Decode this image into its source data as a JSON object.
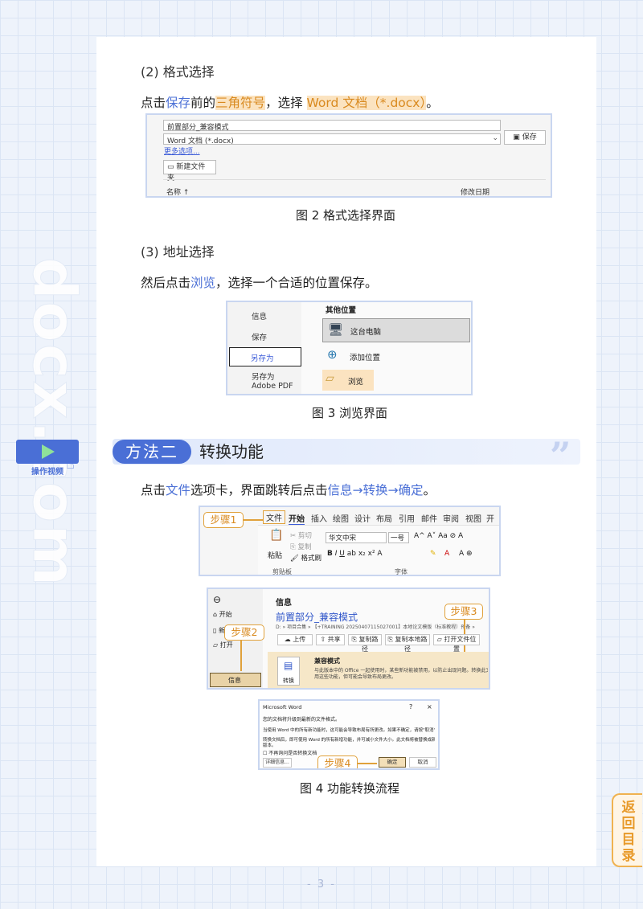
{
  "watermark": "docx.com",
  "section3": {
    "title": "(2) 格式选择"
  },
  "para1": {
    "p1": "点击",
    "p2": "保存",
    "p3": "前的",
    "p4": "三角符号",
    "p5": "，选择 ",
    "p6": "Word 文档（*.docx）",
    "p7": "。"
  },
  "fig2": {
    "filename": "前置部分_兼容模式",
    "filetype": "Word 文档 (*.docx)",
    "more_options": "更多选项...",
    "save_label": "保存",
    "new_folder_label": "新建文件夹",
    "col_name": "名称 ↑",
    "col_date": "修改日期"
  },
  "caption2": "图 2  格式选择界面",
  "section4": {
    "title": "(3) 地址选择"
  },
  "para2": {
    "p1": "然后点击",
    "p2": "浏览",
    "p3": "，选择一个合适的位置保存。"
  },
  "fig3": {
    "items": [
      "信息",
      "保存",
      "另存为",
      "另存为 Adobe PDF"
    ],
    "heading": "其他位置",
    "options": [
      "这台电脑",
      "添加位置",
      "浏览"
    ]
  },
  "caption3": "图 3  浏览界面",
  "method": {
    "pill": "方法二",
    "title": "转换功能"
  },
  "video_btn_label": "操作视频",
  "para3": {
    "p1": "点击",
    "p2": "文件",
    "p3": "选项卡，界面跳转后点击",
    "p4": "信息→转换→确定",
    "p5": "。"
  },
  "fig4a": {
    "step": "步骤1",
    "tabs": [
      "文件",
      "开始",
      "插入",
      "绘图",
      "设计",
      "布局",
      "引用",
      "邮件",
      "审阅",
      "视图",
      "开发"
    ],
    "clip_items": [
      "剪切",
      "复制",
      "格式刷"
    ],
    "paste": "粘贴",
    "font_name": "华文中宋",
    "font_size": "一号",
    "group_clipboard": "剪贴板",
    "group_font": "字体"
  },
  "fig4b": {
    "step2": "步骤2",
    "step3": "步骤3",
    "nav": [
      "开始",
      "新建",
      "打开",
      "信息"
    ],
    "info_title": "信息",
    "doc_title": "前置部分_兼容模式",
    "doc_path": "D: » 项目合集 » 【+TRAINING 20250407115027001】本地论文模版（标准教程）预备 » 资料",
    "actions": [
      "上传",
      "共享",
      "复制路径",
      "复制本地路径",
      "打开文件位置"
    ],
    "compat_title": "兼容模式",
    "compat_desc1": "与此版本中的 Office 一起使用时，某些新功能被禁用，以防止出现问题。转换此文件将启",
    "compat_desc2": "用这些功能，但可能会导致布局更改。",
    "convert_label": "转换"
  },
  "fig4c": {
    "step4": "步骤4",
    "dialog_title": "Microsoft Word",
    "q": "?",
    "x": "×",
    "line1": "您的文档将升级到最新的文件格式。",
    "line2": "当使用 Word 中的所有新功能时，这可能会导致布局有所更改。如果不确定，请按\"取消\"。",
    "line3": "转换文档后，即可使用 Word 的所有新增功能，并可减小文件大小。此文档将被替换成新的",
    "line4": "版本。",
    "checkbox_label": "不再询问是否转换文档",
    "details": "详细信息...",
    "ok": "确定",
    "cancel": "取消"
  },
  "caption4": "图 4  功能转换流程",
  "back_btn": "返回目录",
  "page_number": "- 3 -"
}
